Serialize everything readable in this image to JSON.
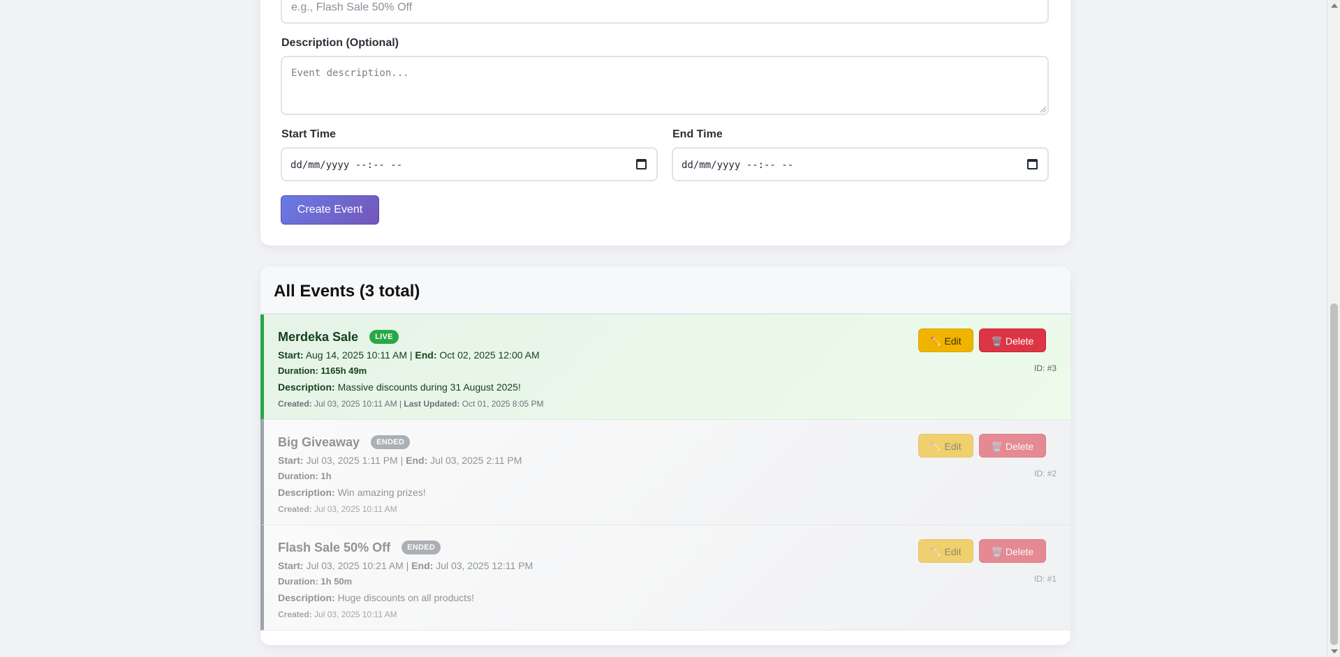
{
  "form": {
    "name_placeholder": "e.g., Flash Sale 50% Off",
    "description_label": "Description (Optional)",
    "description_placeholder": "Event description...",
    "start_label": "Start Time",
    "end_label": "End Time",
    "start_value": "dd/mm/yyyy --:-- --",
    "end_value": "dd/mm/yyyy --:-- --",
    "create_button": "Create Event"
  },
  "events_section": {
    "title": "All Events (3 total)"
  },
  "labels": {
    "start": "Start:",
    "end": "End:",
    "duration": "Duration:",
    "description": "Description:",
    "created": "Created:",
    "last_updated": "Last Updated:",
    "separator": "|",
    "edit": "Edit",
    "delete": "Delete"
  },
  "events": [
    {
      "title": "Merdeka Sale",
      "status": "LIVE",
      "start": "Aug 14, 2025 10:11 AM",
      "end": "Oct 02, 2025 12:00 AM",
      "duration": "1165h 49m",
      "description": "Massive discounts during 31 August 2025!",
      "created": "Jul 03, 2025 10:11 AM",
      "last_updated": "Oct 01, 2025 8:05 PM",
      "id": "ID: #3"
    },
    {
      "title": "Big Giveaway",
      "status": "ENDED",
      "start": "Jul 03, 2025 1:11 PM",
      "end": "Jul 03, 2025 2:11 PM",
      "duration": "1h",
      "description": "Win amazing prizes!",
      "created": "Jul 03, 2025 10:11 AM",
      "id": "ID: #2"
    },
    {
      "title": "Flash Sale 50% Off",
      "status": "ENDED",
      "start": "Jul 03, 2025 10:21 AM",
      "end": "Jul 03, 2025 12:11 PM",
      "duration": "1h 50m",
      "description": "Huge discounts on all products!",
      "created": "Jul 03, 2025 10:11 AM",
      "id": "ID: #1"
    }
  ],
  "icons": {
    "edit": "pencil-icon",
    "delete": "trash-icon",
    "calendar": "calendar-icon"
  },
  "colors": {
    "live_accent": "#28a745",
    "ended_accent": "#6c757d",
    "edit_button": "#f0b400",
    "delete_button": "#dc3545",
    "primary_gradient_start": "#6a7be6",
    "primary_gradient_end": "#7456b8"
  }
}
